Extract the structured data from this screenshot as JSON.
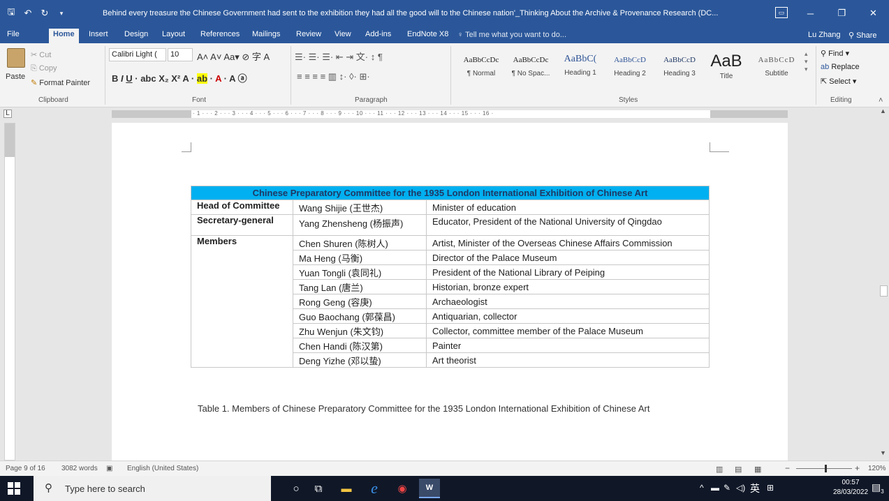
{
  "window": {
    "title": "Behind every treasure the Chinese Government had sent to the exhibition they had all the good will to the Chinese nation'_Thinking About the Archive & Provenance Research (DC...",
    "quick_access": [
      "save-icon",
      "undo-icon",
      "redo-icon",
      "customize-icon"
    ]
  },
  "tabs": [
    "File",
    "Home",
    "Insert",
    "Design",
    "Layout",
    "References",
    "Mailings",
    "Review",
    "View",
    "Add-ins",
    "EndNote X8"
  ],
  "tell_me": "Tell me what you want to do...",
  "user": "Lu Zhang",
  "share": "Share",
  "ribbon": {
    "clipboard": {
      "paste": "Paste",
      "cut": "Cut",
      "copy": "Copy",
      "format_painter": "Format Painter",
      "label": "Clipboard"
    },
    "font": {
      "name": "Calibri Light (",
      "size": "10",
      "label": "Font"
    },
    "paragraph": {
      "label": "Paragraph"
    },
    "styles": {
      "items": [
        {
          "preview": "AaBbCcDc",
          "name": "¶ Normal"
        },
        {
          "preview": "AaBbCcDc",
          "name": "¶ No Spac..."
        },
        {
          "preview": "AaBbC(",
          "name": "Heading 1"
        },
        {
          "preview": "AaBbCcD",
          "name": "Heading 2"
        },
        {
          "preview": "AaBbCcD",
          "name": "Heading 3"
        },
        {
          "preview": "AaB",
          "name": "Title"
        },
        {
          "preview": "AaBbCcD",
          "name": "Subtitle"
        }
      ],
      "label": "Styles"
    },
    "editing": {
      "find": "Find",
      "replace": "Replace",
      "select": "Select",
      "label": "Editing"
    }
  },
  "document": {
    "table_title": "Chinese Preparatory Committee for the 1935 London International Exhibition of Chinese Art",
    "rows": [
      {
        "role": "Head of Committee",
        "name": "Wang Shijie (王世杰)",
        "desc": "Minister of education"
      },
      {
        "role": "Secretary-general",
        "name": "Yang Zhensheng (杨振声)",
        "desc": "Educator, President of the National University of Qingdao"
      },
      {
        "role": "Members",
        "name": "Chen Shuren (陈树人)",
        "desc": "Artist, Minister of the Overseas Chinese Affairs Commission"
      },
      {
        "role": "",
        "name": "Ma Heng (马衡)",
        "desc": "Director of the Palace Museum"
      },
      {
        "role": "",
        "name": "Yuan Tongli (袁同礼)",
        "desc": "President of the National Library of Peiping"
      },
      {
        "role": "",
        "name": "Tang Lan (唐兰)",
        "desc": "Historian, bronze expert"
      },
      {
        "role": "",
        "name": "Rong Geng (容庚)",
        "desc": "Archaeologist"
      },
      {
        "role": "",
        "name": "Guo Baochang (郭葆昌)",
        "desc": "Antiquarian, collector"
      },
      {
        "role": "",
        "name": "Zhu Wenjun (朱文钧)",
        "desc": "Collector, committee member of the Palace Museum"
      },
      {
        "role": "",
        "name": "Chen Handi (陈汉第)",
        "desc": "Painter"
      },
      {
        "role": "",
        "name": "Deng Yizhe (邓以蛰)",
        "desc": "Art theorist"
      }
    ],
    "caption": "Table 1. Members of Chinese Preparatory Committee for the 1935 London International Exhibition of Chinese Art"
  },
  "status": {
    "page": "Page 9 of 16",
    "words": "3082 words",
    "language": "English (United States)",
    "zoom": "120%"
  },
  "taskbar": {
    "search_placeholder": "Type here to search",
    "time": "00:57",
    "date": "28/03/2022",
    "ime": "英",
    "notifications": "3"
  }
}
